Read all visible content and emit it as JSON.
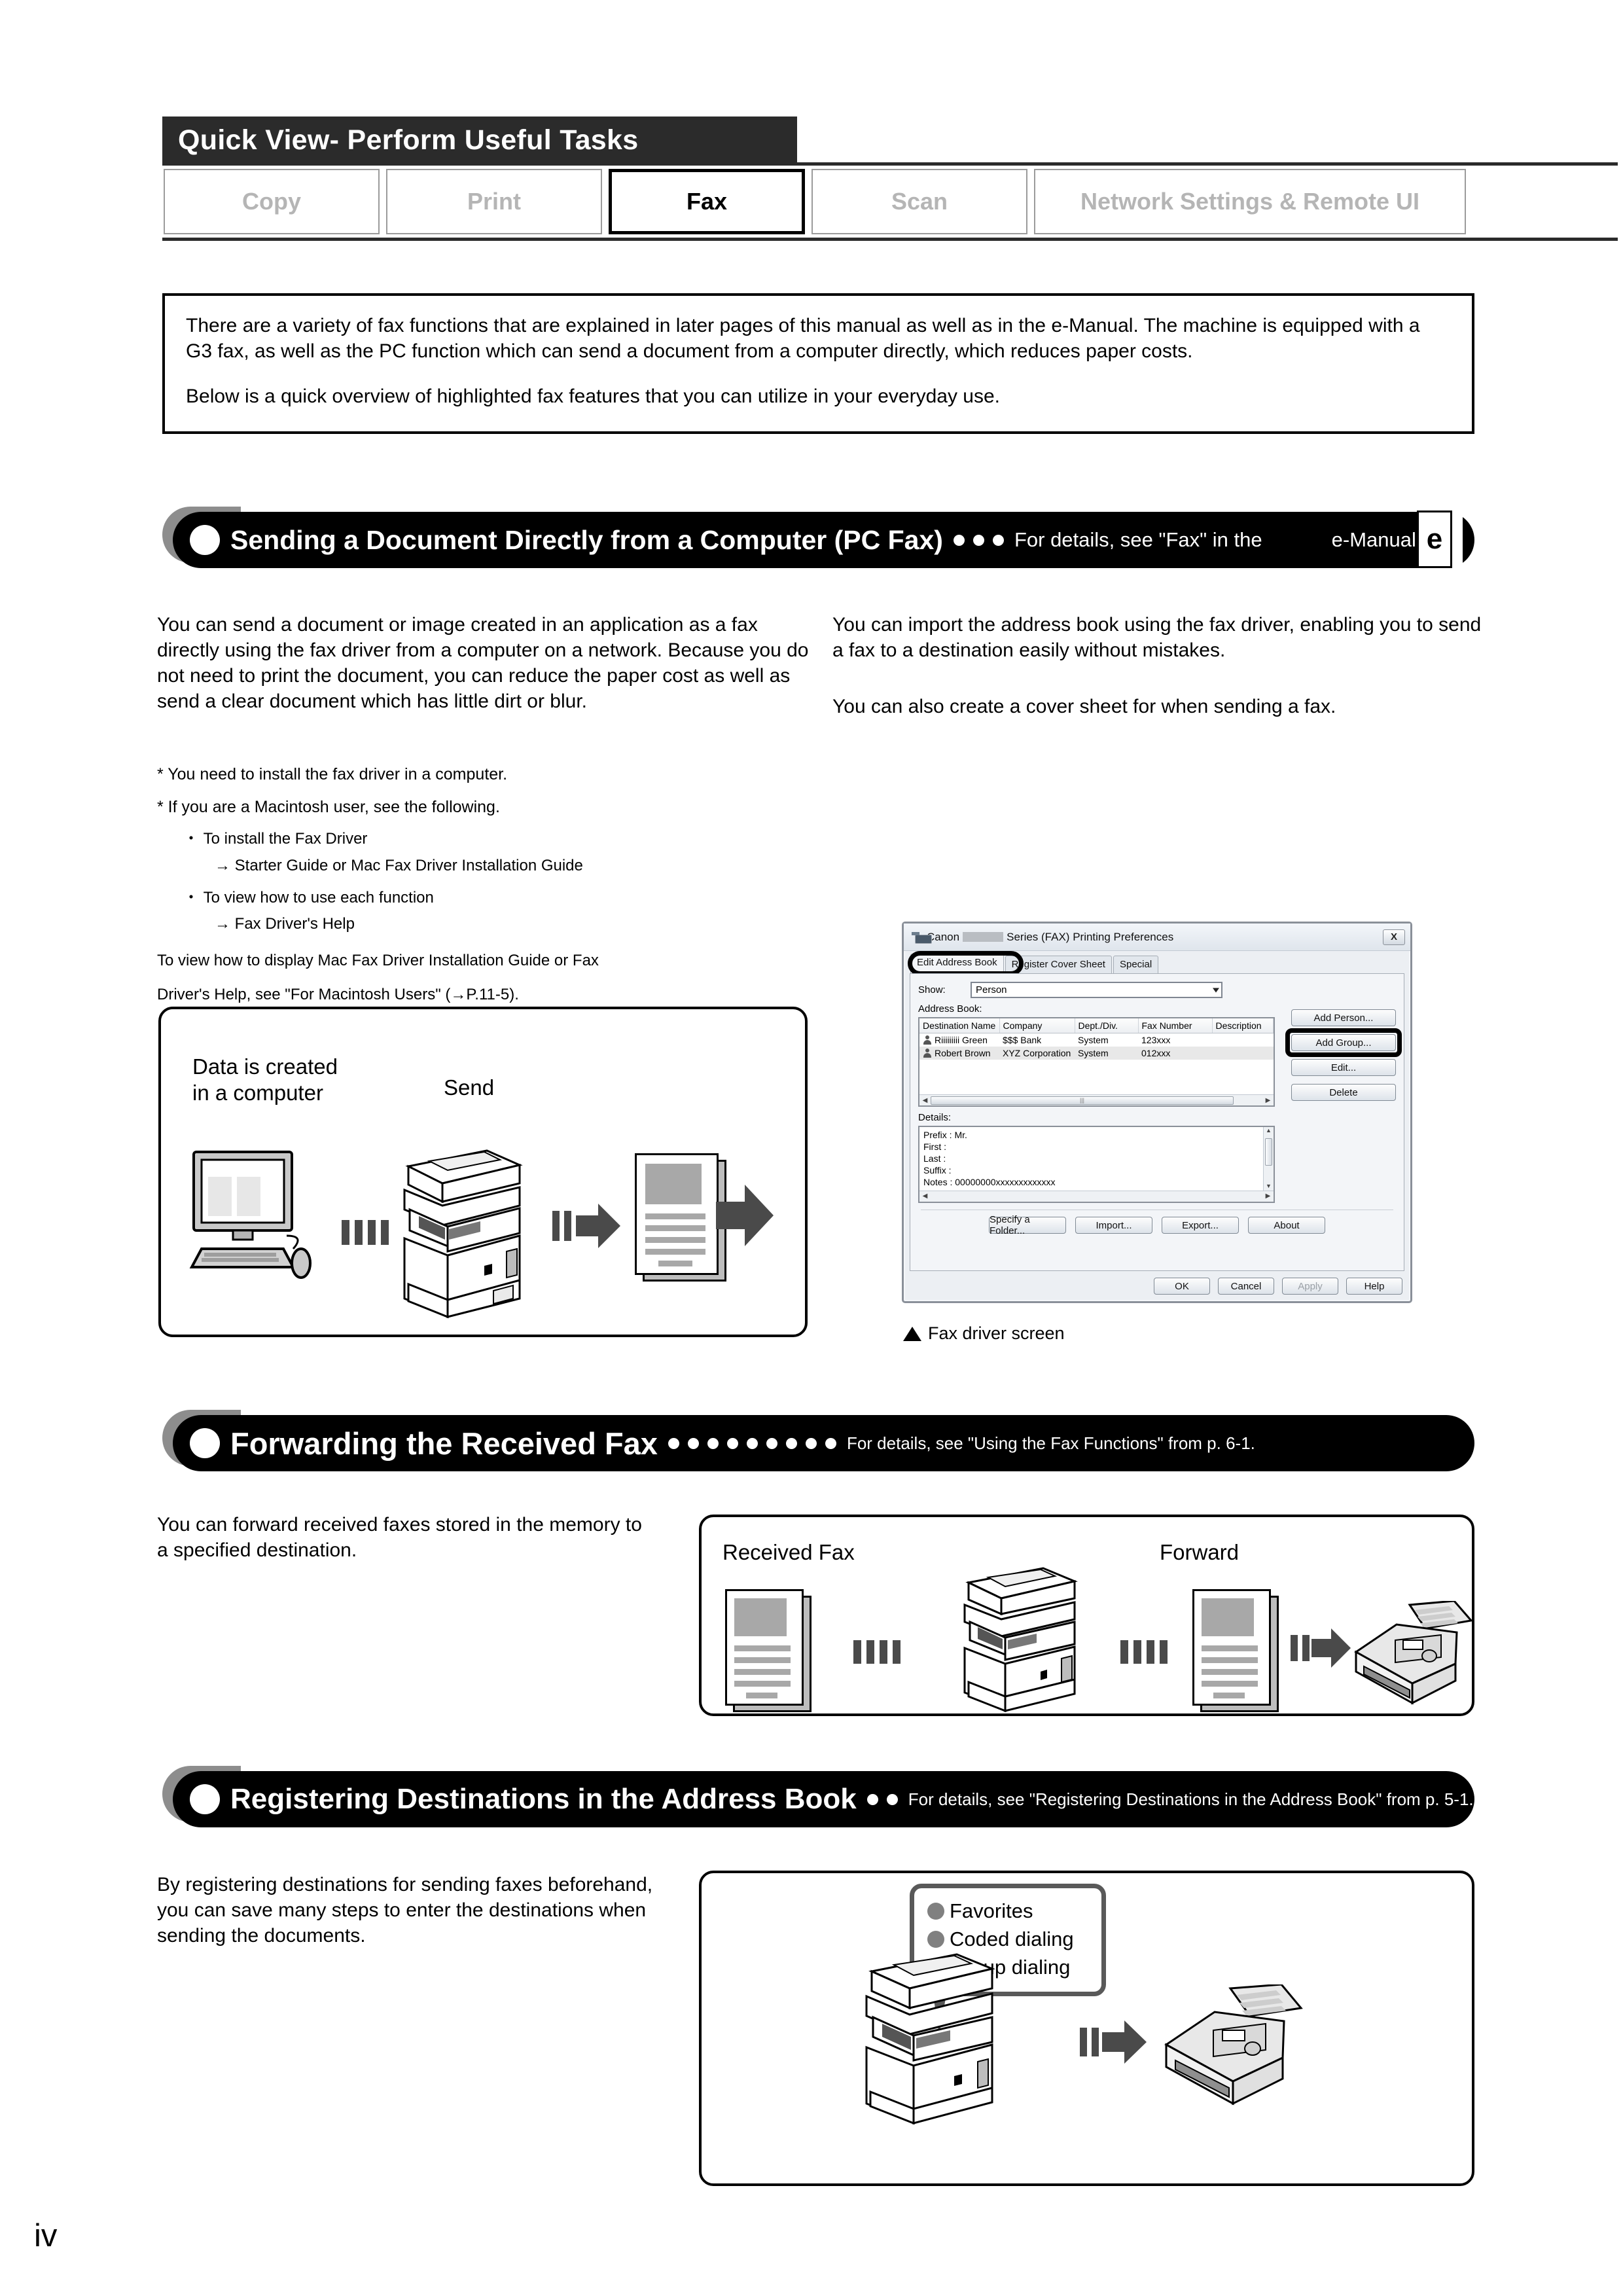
{
  "header": {
    "band_title": "Quick View- Perform Useful Tasks",
    "tabs": [
      {
        "label": "Copy",
        "active": false
      },
      {
        "label": "Print",
        "active": false
      },
      {
        "label": "Fax",
        "active": true
      },
      {
        "label": "Scan",
        "active": false
      },
      {
        "label": "Network Settings & Remote UI",
        "active": false
      }
    ]
  },
  "intro": {
    "p1": "There are a variety of fax functions that are explained in later pages of this manual as well as in the e-Manual.  The machine is equipped with a G3 fax, as well as the PC function which can send a document from a computer directly, which reduces paper costs.",
    "p2": "Below is a quick overview of highlighted fax features that you can utilize in your everyday use."
  },
  "section1": {
    "title": "Sending a Document Directly from a Computer (PC Fax)",
    "note_pre": "For details, see \"Fax\" in the",
    "note_post": "e-Manual.",
    "book_glyph": "e",
    "left_text": "You can send a document or image created in an application as a fax directly using the fax driver from a computer on a network. Because you do not need to print the document, you can reduce the paper cost as well as send a clear document which has little dirt or blur.",
    "right_text_1": "You can import the address book using the fax driver, enabling you to send a fax to a destination easily without mistakes.",
    "right_text_2": "You can also create a cover sheet for when sending a fax.",
    "notes": {
      "ast1": "*  You need to install the fax driver in a computer.",
      "ast2": "*  If you are a Macintosh user, see the following.",
      "bul1": "・ To install the Fax Driver",
      "arw1": "→ Starter Guide or Mac Fax Driver Installation Guide",
      "bul2": "・ To view how to use each function",
      "arw2": "→ Fax Driver's Help",
      "tail1": "To view how to display Mac Fax Driver Installation Guide or Fax",
      "tail2": "Driver's Help, see \"For Macintosh Users\" (→P.11-5)."
    },
    "panel": {
      "label_computer": "Data is created\nin a computer",
      "label_send": "Send"
    },
    "caption": "Fax driver screen"
  },
  "dialog": {
    "title_pre": "Canon",
    "title_post": "Series (FAX) Printing Preferences",
    "close_label": "X",
    "tabs": [
      {
        "label": "Edit Address Book",
        "selected": true
      },
      {
        "label": "Register Cover Sheet",
        "selected": false
      },
      {
        "label": "Special",
        "selected": false
      }
    ],
    "show_label": "Show:",
    "show_value": "Person",
    "addressbook_label": "Address Book:",
    "columns": [
      "Destination Name",
      "Company",
      "Dept./Div.",
      "Fax Number",
      "Description"
    ],
    "rows": [
      {
        "name": "Riiiiiiiii Green",
        "company": "$$$ Bank",
        "dept": "System",
        "fax": "123xxx",
        "desc": ""
      },
      {
        "name": "Robert Brown",
        "company": "XYZ Corporation",
        "dept": "System",
        "fax": "012xxx",
        "desc": ""
      }
    ],
    "side_buttons": [
      {
        "label": "Add Person...",
        "highlighted": false
      },
      {
        "label": "Add Group...",
        "highlighted": true
      },
      {
        "label": "Edit...",
        "highlighted": false
      },
      {
        "label": "Delete",
        "highlighted": false
      }
    ],
    "details_label": "Details:",
    "details_lines": [
      "Prefix : Mr.",
      "First   :",
      "Last    :",
      "Suffix :",
      "Notes : 00000000xxxxxxxxxxxxx"
    ],
    "bottom_buttons": [
      "Specify a Folder...",
      "Import...",
      "Export...",
      "About"
    ],
    "footer_buttons": [
      {
        "label": "OK",
        "disabled": false
      },
      {
        "label": "Cancel",
        "disabled": false
      },
      {
        "label": "Apply",
        "disabled": true
      },
      {
        "label": "Help",
        "disabled": false
      }
    ]
  },
  "section2": {
    "title": "Forwarding the Received Fax",
    "note": "For details, see \"Using the Fax Functions\" from p. 6-1.",
    "left_text": "You can forward received faxes stored in the memory to a specified destination.",
    "panel": {
      "label_received": "Received Fax",
      "label_forward": "Forward"
    }
  },
  "section3": {
    "title": "Registering Destinations in the Address Book",
    "note": "For details, see \"Registering Destinations in the Address Book\" from p. 5-1.",
    "left_text": "By registering destinations for sending faxes beforehand, you can save many steps to enter the destinations when sending the documents.",
    "bubble_items": [
      "Favorites",
      "Coded dialing",
      "Group dialing"
    ]
  },
  "page_number": "iv"
}
